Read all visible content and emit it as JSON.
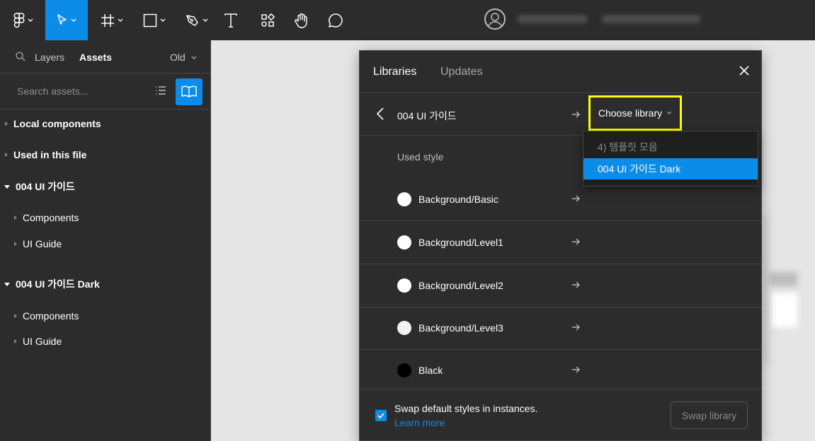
{
  "toolbar": {
    "tools": [
      {
        "name": "figma-menu",
        "icon": "figma-logo-icon"
      },
      {
        "name": "move",
        "icon": "cursor-icon",
        "active": true
      },
      {
        "name": "frame",
        "icon": "frame-icon"
      },
      {
        "name": "shape",
        "icon": "rectangle-icon"
      },
      {
        "name": "pen",
        "icon": "pen-icon"
      },
      {
        "name": "text",
        "icon": "text-icon"
      },
      {
        "name": "resources",
        "icon": "components-icon"
      },
      {
        "name": "hand",
        "icon": "hand-icon"
      },
      {
        "name": "comment",
        "icon": "comment-icon"
      }
    ],
    "accent": "#0c8ce9"
  },
  "left_panel": {
    "tab_layers": "Layers",
    "tab_assets": "Assets",
    "old_label": "Old",
    "search_placeholder": "Search assets...",
    "tree": [
      {
        "label": "Local components",
        "bold": true,
        "expanded": false
      },
      {
        "label": "Used in this file",
        "bold": true,
        "expanded": false
      },
      {
        "label": "004 UI 가이드",
        "bold": true,
        "expanded": true
      },
      {
        "label": "Components",
        "bold": false,
        "expanded": false
      },
      {
        "label": "UI Guide",
        "bold": false,
        "expanded": false
      },
      {
        "label": "004 UI 가이드 Dark",
        "bold": true,
        "expanded": true
      },
      {
        "label": "Components",
        "bold": false,
        "expanded": false
      },
      {
        "label": "UI Guide",
        "bold": false,
        "expanded": false
      }
    ]
  },
  "dialog": {
    "tab_libraries": "Libraries",
    "tab_updates": "Updates",
    "current_library": "004 UI 가이드",
    "choose_library": "Choose library",
    "used_style": "Used style",
    "styles": [
      {
        "label": "Background/Basic",
        "color": "#ffffff"
      },
      {
        "label": "Background/Level1",
        "color": "#ffffff"
      },
      {
        "label": "Background/Level2",
        "color": "#ffffff"
      },
      {
        "label": "Background/Level3",
        "color": "#f2f2f2"
      },
      {
        "label": "Black",
        "color": "#000000"
      }
    ],
    "dropdown": {
      "items": [
        {
          "label": "4) 템플릿 모음",
          "selected": false
        },
        {
          "label": "004 UI 가이드 Dark",
          "selected": true
        }
      ]
    },
    "swap_defaults": "Swap default styles in instances.",
    "learn_more": "Learn more",
    "swap_button": "Swap library"
  }
}
